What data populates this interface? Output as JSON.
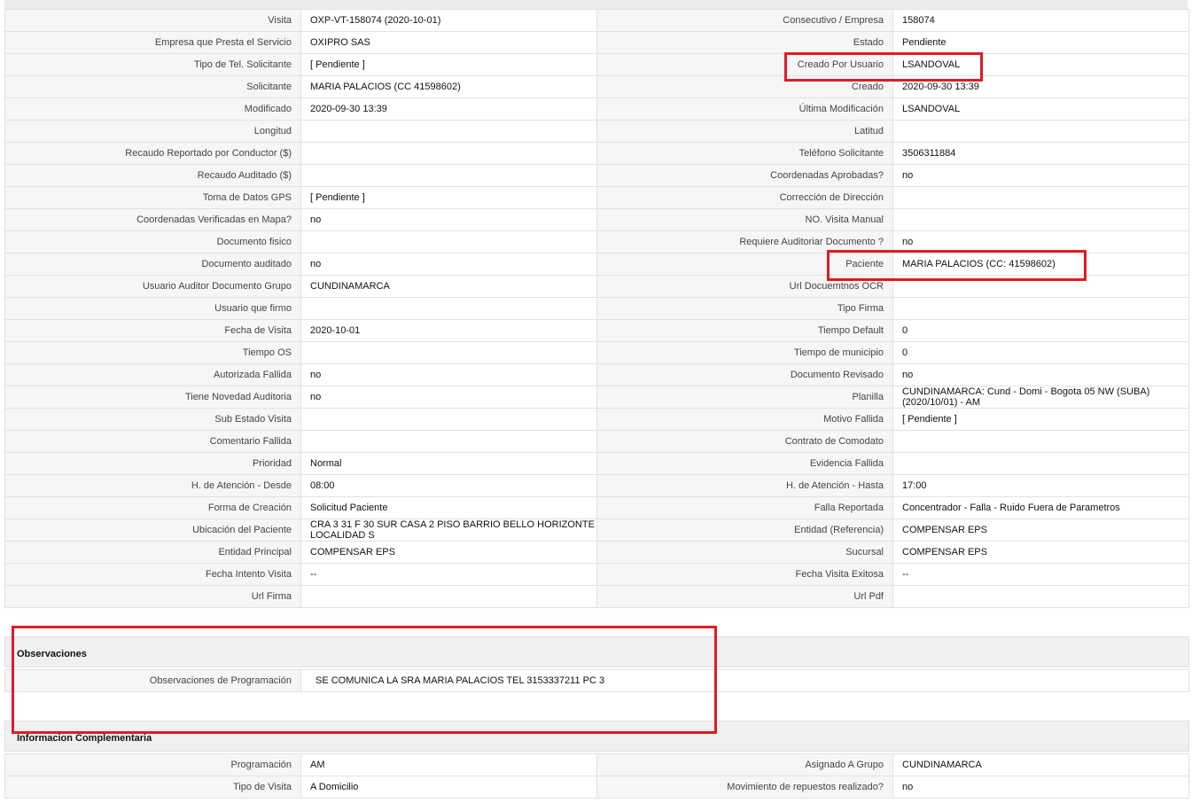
{
  "details": {
    "rows": [
      {
        "l1": "Visita",
        "v1": "OXP-VT-158074 (2020-10-01)",
        "l2": "Consecutivo / Empresa",
        "v2": "158074"
      },
      {
        "l1": "Empresa que Presta el Servicio",
        "v1": "OXIPRO SAS",
        "l2": "Estado",
        "v2": "Pendiente"
      },
      {
        "l1": "Tipo de Tel. Solicitante",
        "v1": "[ Pendiente ]",
        "l2": "Creado Por Usuario",
        "v2": "LSANDOVAL"
      },
      {
        "l1": "Solicitante",
        "v1": "MARIA PALACIOS (CC 41598602)",
        "l2": "Creado",
        "v2": "2020-09-30 13:39"
      },
      {
        "l1": "Modificado",
        "v1": "2020-09-30 13:39",
        "l2": "Última Modificación",
        "v2": " LSANDOVAL"
      },
      {
        "l1": "Longitud",
        "v1": "",
        "l2": "Latitud",
        "v2": ""
      },
      {
        "l1": "Recaudo Reportado por Conductor ($)",
        "v1": "",
        "l2": "Teléfono Solicitante",
        "v2": "3506311884"
      },
      {
        "l1": "Recaudo Auditado ($)",
        "v1": "",
        "l2": "Coordenadas Aprobadas?",
        "v2": " no"
      },
      {
        "l1": "Toma de Datos GPS",
        "v1": "[ Pendiente ]",
        "l2": "Corrección de Dirección",
        "v2": ""
      },
      {
        "l1": "Coordenadas Verificadas en Mapa?",
        "v1": " no",
        "l2": "NO. Visita Manual",
        "v2": ""
      },
      {
        "l1": "Documento fisico",
        "v1": "",
        "l2": "Requiere Auditoriar Documento ?",
        "v2": " no"
      },
      {
        "l1": "Documento auditado",
        "v1": " no",
        "l2": "Paciente",
        "v2": "MARIA PALACIOS (CC: 41598602)"
      },
      {
        "l1": "Usuario Auditor Documento Grupo",
        "v1": "CUNDINAMARCA",
        "l2": "Url Docuemtnos OCR",
        "v2": ""
      },
      {
        "l1": "Usuario que firmo",
        "v1": "",
        "l2": "Tipo Firma",
        "v2": ""
      },
      {
        "l1": "Fecha de Visita",
        "v1": " 2020-10-01",
        "l2": "Tiempo Default",
        "v2": "0"
      },
      {
        "l1": "Tiempo OS",
        "v1": "",
        "l2": "Tiempo de municipio",
        "v2": "0"
      },
      {
        "l1": "Autorizada Fallida",
        "v1": " no",
        "l2": "Documento Revisado",
        "v2": " no"
      },
      {
        "l1": "Tiene Novedad Auditoria",
        "v1": " no",
        "l2": "Planilla",
        "v2": "CUNDINAMARCA: Cund - Domi - Bogota 05 NW (SUBA) (2020/10/01) - AM"
      },
      {
        "l1": "Sub Estado Visita",
        "v1": "",
        "l2": "Motivo Fallida",
        "v2": "[ Pendiente ]"
      },
      {
        "l1": "Comentario Fallida",
        "v1": "",
        "l2": "Contrato de Comodato",
        "v2": ""
      },
      {
        "l1": "Prioridad",
        "v1": "Normal",
        "l2": "Evidencia Fallida",
        "v2": ""
      },
      {
        "l1": "H. de Atención - Desde",
        "v1": "08:00",
        "l2": "H. de Atención - Hasta",
        "v2": "17:00"
      },
      {
        "l1": "Forma de Creación",
        "v1": "Solicitud Paciente",
        "l2": "Falla Reportada",
        "v2": "Concentrador - Falla - Ruido Fuera de Parametros"
      },
      {
        "l1": "Ubicación del Paciente",
        "v1": "CRA 3 31 F 30 SUR CASA 2 PISO BARRIO BELLO HORIZONTE LOCALIDAD S",
        "l2": "Entidad (Referencia)",
        "v2": "COMPENSAR EPS"
      },
      {
        "l1": "Entidad Principal",
        "v1": "COMPENSAR EPS",
        "l2": "Sucursal",
        "v2": "COMPENSAR EPS"
      },
      {
        "l1": "Fecha Intento Visita",
        "v1": " --",
        "l2": "Fecha Visita Exitosa",
        "v2": " --"
      },
      {
        "l1": "Url Firma",
        "v1": "",
        "l2": "Url Pdf",
        "v2": ""
      }
    ]
  },
  "observaciones": {
    "title": "Observaciones",
    "label": "Observaciones de Programación",
    "value": "SE COMUNICA LA SRA MARIA PALACIOS TEL 3153337211 PC 3"
  },
  "complementaria": {
    "title": "Informacion Complementaria",
    "rows": [
      {
        "l1": "Programación",
        "v1": "AM",
        "l2": "Asignado A Grupo",
        "v2": "CUNDINAMARCA"
      },
      {
        "l1": "Tipo de Visita",
        "v1": "A Domicilio",
        "l2": "Movimiento de repuestos realizado?",
        "v2": " no"
      }
    ]
  },
  "colors": {
    "highlight": "#e01b24",
    "label_bg": "#f6f6f6",
    "section_bg": "#f0f0f0"
  }
}
